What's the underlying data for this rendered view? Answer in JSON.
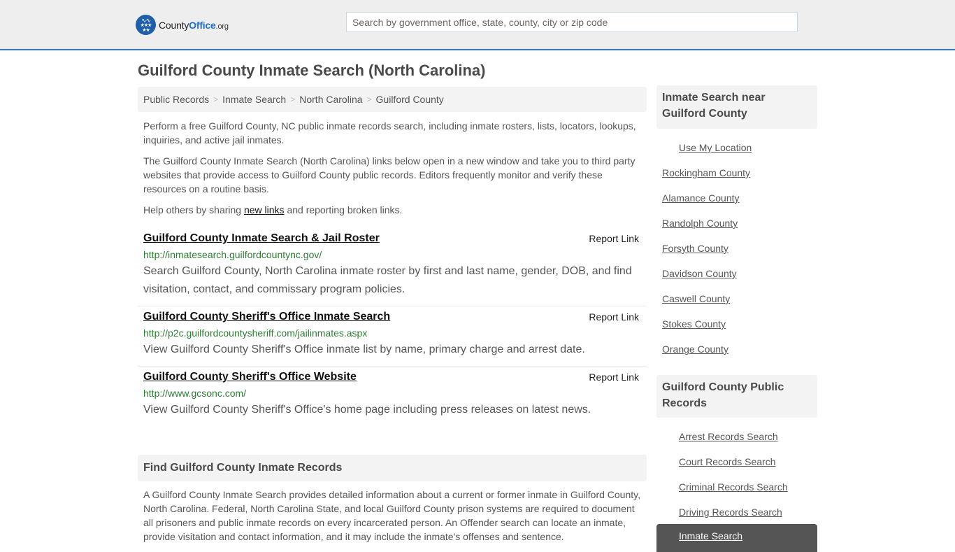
{
  "header": {
    "logo": {
      "name_part1": "County",
      "name_part2": "Office",
      "name_part3": ".org",
      "icon": "eagle-stars-badge"
    },
    "search": {
      "placeholder": "Search by government office, state, county, city or zip code",
      "value": ""
    },
    "colors": {
      "accent": "#337ab7",
      "brand_blue": "#1f5fa8",
      "header_bg": "#eeeeee"
    }
  },
  "main": {
    "title": "Guilford County Inmate Search (North Carolina)",
    "breadcrumb": [
      "Public Records",
      "Inmate Search",
      "North Carolina",
      "Guilford County"
    ],
    "breadcrumb_separator": ">",
    "intro": {
      "p1": "Perform a free Guilford County, NC public inmate records search, including inmate rosters, lists, locators, lookups, inquiries, and active jail inmates.",
      "p2": "The Guilford County Inmate Search (North Carolina) links below open in a new window and take you to third party websites that provide access to Guilford County public records. Editors frequently monitor and verify these resources on a routine basis.",
      "p3_before": "Help others by sharing ",
      "p3_link": "new links",
      "p3_after": " and reporting broken links."
    },
    "links": [
      {
        "title": "Guilford County Inmate Search & Jail Roster",
        "url": "http://inmatesearch.guilfordcountync.gov/",
        "description": "Search Guilford County, North Carolina inmate roster by first and last name, gender, DOB, and find visitation, contact, and commissary program policies.",
        "report_label": "Report Link"
      },
      {
        "title": "Guilford County Sheriff's Office Inmate Search",
        "url": "http://p2c.guilfordcountysheriff.com/jailinmates.aspx",
        "description": "View Guilford County Sheriff's Office inmate list by name, primary charge and arrest date.",
        "report_label": "Report Link"
      },
      {
        "title": "Guilford County Sheriff's Office Website",
        "url": "http://www.gcsonc.com/",
        "description": "View Guilford County Sheriff's Office's home page including press releases on latest news.",
        "report_label": "Report Link"
      }
    ],
    "find_section": {
      "heading": "Find Guilford County Inmate Records",
      "body": "A Guilford County Inmate Search provides detailed information about a current or former inmate in Guilford County, North Carolina. Federal, North Carolina State, and local Guilford County prison systems are required to document all prisoners and public inmate records on every incarcerated person. An Offender search can locate an inmate, provide visitation and contact information, and it may include the inmate's offenses and sentence."
    }
  },
  "sidebar": {
    "nearby": {
      "heading": "Inmate Search near Guilford County",
      "use_location": "Use My Location",
      "counties": [
        "Rockingham County",
        "Alamance County",
        "Randolph County",
        "Forsyth County",
        "Davidson County",
        "Caswell County",
        "Stokes County",
        "Orange County"
      ]
    },
    "public_records": {
      "heading": "Guilford County Public Records",
      "items": [
        "Arrest Records Search",
        "Court Records Search",
        "Criminal Records Search",
        "Driving Records Search"
      ],
      "active_item": "Inmate Search"
    }
  }
}
